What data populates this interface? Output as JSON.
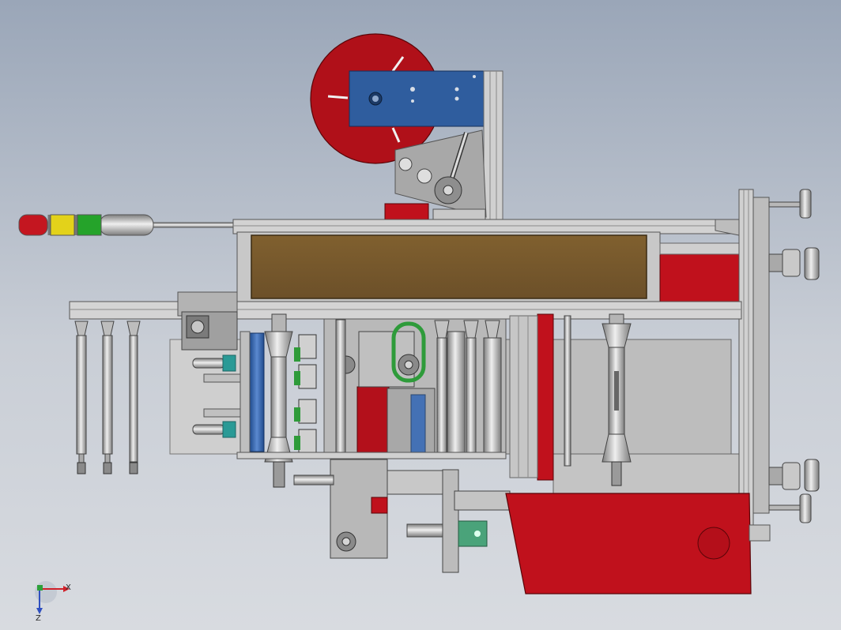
{
  "viewport": {
    "background_top": "#9aa6b8",
    "background_bottom": "#d8dbe0"
  },
  "colors": {
    "steel": "#c8c8c8",
    "steel_dark": "#8f8f8f",
    "red": "#c0111c",
    "red_dark": "#9c0d17",
    "blue_plate": "#2f5d9e",
    "brown_panel": "#7a5a2e",
    "belt_green": "#2e9b3a",
    "bracket_green": "#4aa37a",
    "roller_blue": "#3a6cb7",
    "teal": "#2a9a96"
  },
  "signal_tower": {
    "lamps": [
      {
        "name": "red-lamp",
        "color": "#c41620"
      },
      {
        "name": "yellow-lamp",
        "color": "#e3d21a"
      },
      {
        "name": "green-lamp",
        "color": "#25a32a"
      }
    ]
  },
  "triad": {
    "x_label": "X",
    "z_label": "Z",
    "x_color": "#d0212a",
    "y_color": "#2da13a",
    "z_color": "#2f4fbf"
  }
}
